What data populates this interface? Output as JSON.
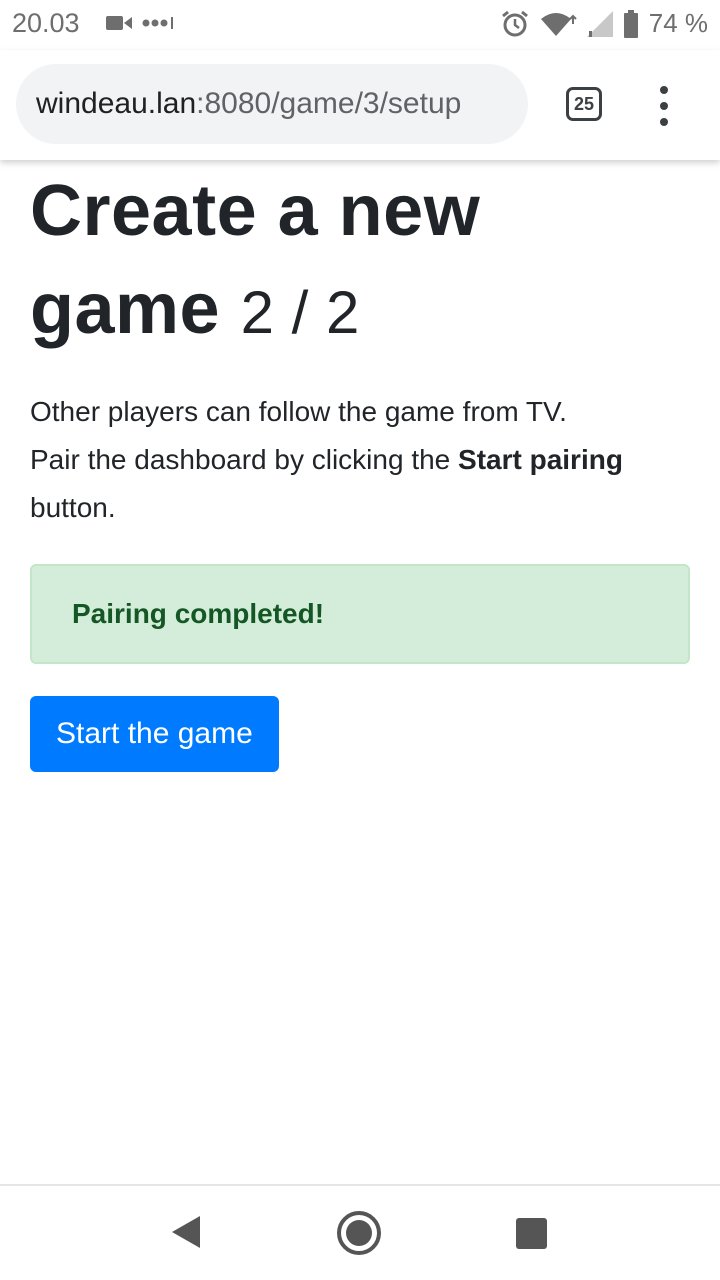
{
  "status_bar": {
    "time": "20.03",
    "battery_percent": "74 %",
    "icons": [
      "video-call-icon",
      "more-notifications-icon",
      "alarm-icon",
      "wifi-icon",
      "signal-icon",
      "battery-icon"
    ]
  },
  "browser": {
    "url_host": "windeau.lan",
    "url_path": ":8080/game/3/setup",
    "tab_count": "25",
    "menu_icon": "more-vert-icon"
  },
  "page": {
    "title": "Create a new game",
    "step": "2 / 2",
    "description_line1": "Other players can follow the game from TV.",
    "description_pre": "Pair the dashboard by clicking the ",
    "description_bold": "Start pairing",
    "description_post": " button.",
    "alert_text": "Pairing completed!",
    "start_button_label": "Start the game"
  },
  "colors": {
    "primary": "#007bff",
    "alert_bg": "#d4edda",
    "alert_text": "#155724"
  },
  "nav_bar": {
    "icons": [
      "back-icon",
      "home-icon",
      "recent-apps-icon"
    ]
  }
}
